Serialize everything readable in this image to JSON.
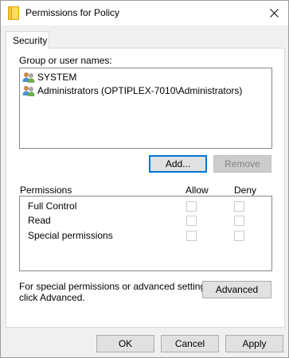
{
  "window": {
    "title": "Permissions for Policy"
  },
  "tabs": [
    {
      "label": "Security"
    }
  ],
  "group_section": {
    "label": "Group or user names:",
    "users": [
      {
        "name": "SYSTEM",
        "icon": "users-icon"
      },
      {
        "name": "Administrators (OPTIPLEX-7010\\Administrators)",
        "icon": "users-icon"
      }
    ],
    "add_label": "Add...",
    "remove_label": "Remove"
  },
  "permissions": {
    "header_label": "Permissions",
    "allow_label": "Allow",
    "deny_label": "Deny",
    "rows": [
      {
        "name": "Full Control",
        "allow": false,
        "deny": false
      },
      {
        "name": "Read",
        "allow": false,
        "deny": false
      },
      {
        "name": "Special permissions",
        "allow": false,
        "deny": false
      }
    ]
  },
  "advanced": {
    "text_line1": "For special permissions or advanced settings,",
    "text_line2": "click Advanced.",
    "button_label": "Advanced"
  },
  "footer": {
    "ok_label": "OK",
    "cancel_label": "Cancel",
    "apply_label": "Apply"
  }
}
